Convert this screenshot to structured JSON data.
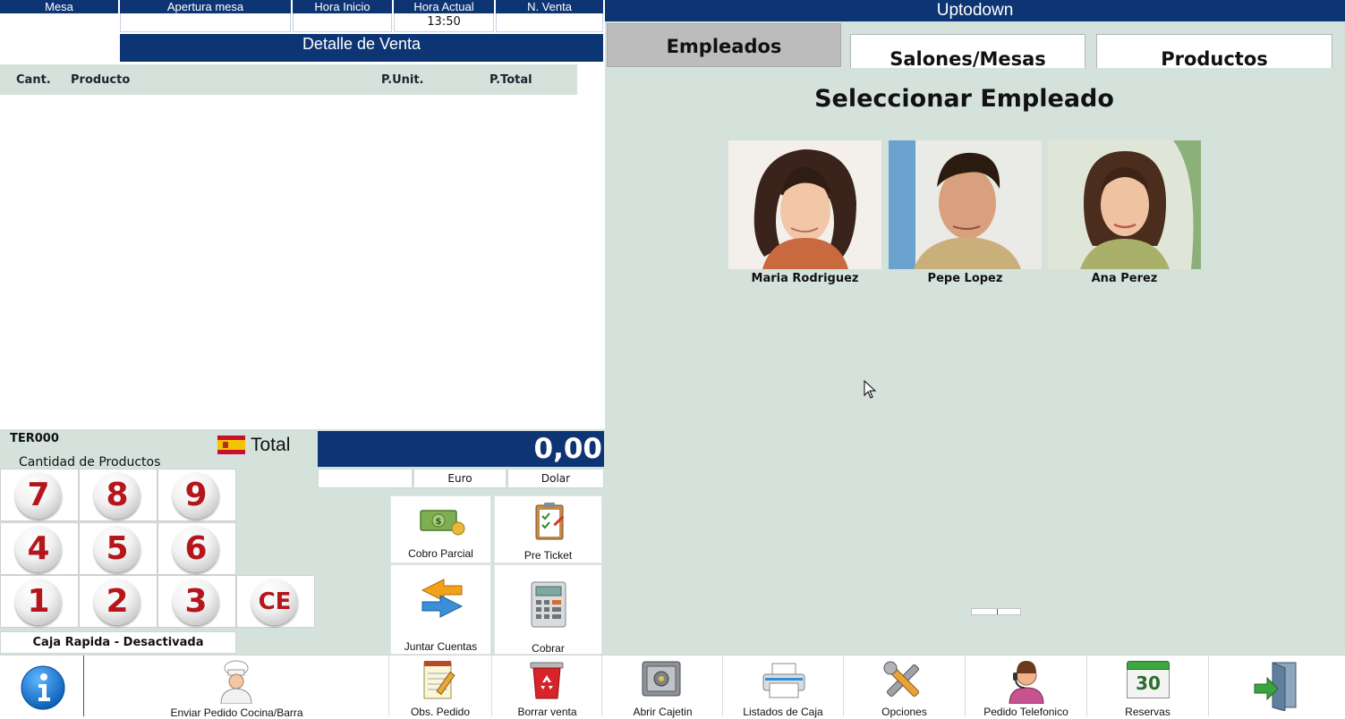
{
  "header": {
    "mesa_label": "Mesa",
    "apertura_label": "Apertura mesa",
    "hora_inicio_label": "Hora Inicio",
    "hora_actual_label": "Hora Actual",
    "hora_actual_value": "13:50",
    "n_venta_label": "N. Venta",
    "detalle_title": "Detalle de Venta"
  },
  "sale_table": {
    "columns": [
      "Cant.",
      "Producto",
      "P.Unit.",
      "P.Total"
    ],
    "rows": []
  },
  "terminal": {
    "id": "TER000",
    "cantidad_label": "Cantidad de Productos",
    "caja_rapida": "Caja Rapida - Desactivada"
  },
  "total": {
    "label": "Total",
    "value": "0,00",
    "currency_tabs": [
      "Euro",
      "Dolar"
    ]
  },
  "keypad": [
    "7",
    "8",
    "9",
    "4",
    "5",
    "6",
    "1",
    "2",
    "3",
    "CE"
  ],
  "actions": {
    "cobro_parcial": "Cobro Parcial",
    "pre_ticket": "Pre Ticket",
    "juntar_cuentas": "Juntar Cuentas",
    "cobrar": "Cobrar"
  },
  "bottom_bar": {
    "info_icon": "info-icon",
    "enviar_pedido": "Enviar Pedido Cocina/Barra",
    "obs_pedido": "Obs. Pedido",
    "borrar_venta": "Borrar venta",
    "abrir_cajetin": "Abrir Cajetin",
    "listados_caja": "Listados de Caja",
    "opciones": "Opciones",
    "pedido_telefonico": "Pedido Telefonico",
    "reservas": "Reservas",
    "reservas_day": "30",
    "exit_icon": "exit-door-icon"
  },
  "right": {
    "window_title": "Uptodown",
    "tabs": [
      "Empleados",
      "Salones/Mesas",
      "Productos"
    ],
    "heading": "Seleccionar Empleado",
    "employees": [
      {
        "name": "Maria Rodriguez"
      },
      {
        "name": "Pepe Lopez"
      },
      {
        "name": "Ana Perez"
      }
    ]
  },
  "colors": {
    "navy": "#0d3574",
    "panel": "#d5e2dc",
    "keypad_digit": "#b5161c"
  }
}
